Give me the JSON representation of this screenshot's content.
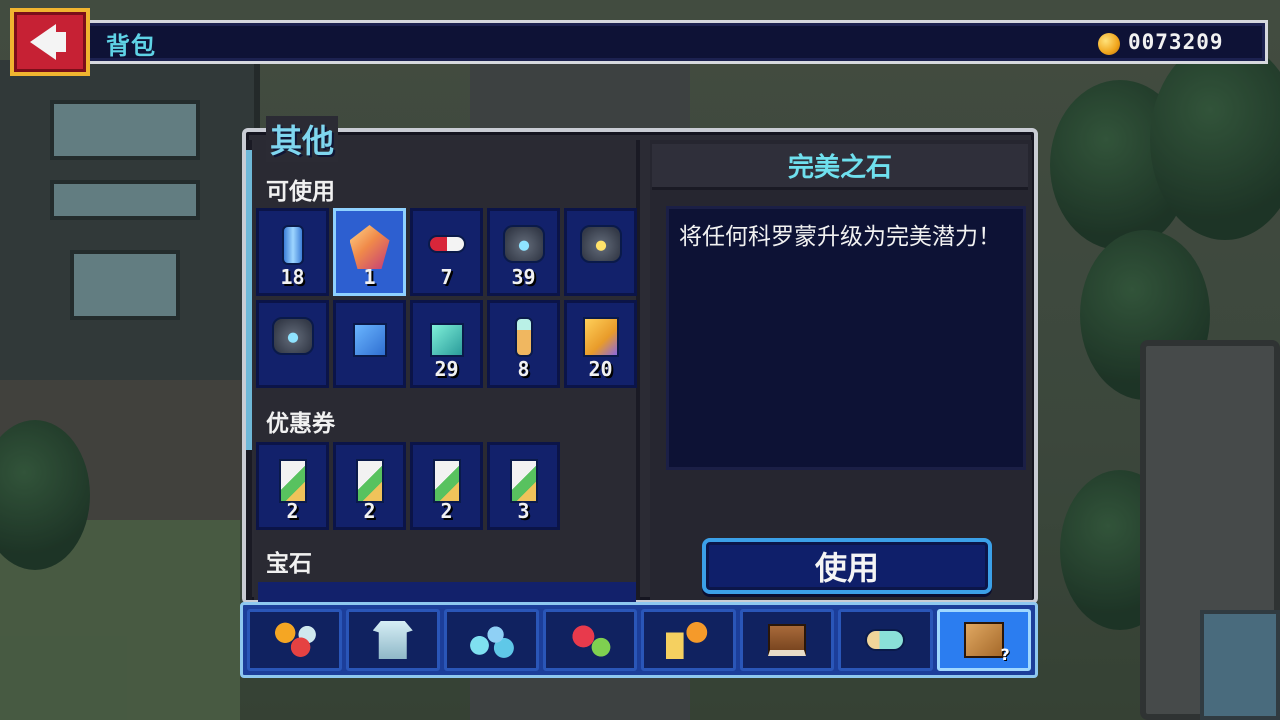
{
  "header": {
    "title": "背包",
    "coin_count": "0073209",
    "back_icon": "left-arrow-icon",
    "coin_icon": "gold-coin-icon"
  },
  "panel": {
    "title": "其他"
  },
  "sections": {
    "usable": {
      "label": "可使用",
      "items": [
        {
          "icon": "blue-cylinder-icon",
          "count": "18"
        },
        {
          "icon": "perfect-stone-gem-icon",
          "count": "1",
          "selected": true
        },
        {
          "icon": "capsule-pill-icon",
          "count": "7"
        },
        {
          "icon": "blue-core-stone-icon",
          "count": "39"
        },
        {
          "icon": "gold-core-stone-icon",
          "count": ""
        },
        {
          "icon": "blue-core-stone-icon",
          "count": ""
        },
        {
          "icon": "blue-diamond-icon",
          "count": ""
        },
        {
          "icon": "teal-diamond-icon",
          "count": "29"
        },
        {
          "icon": "potion-bottle-icon",
          "count": "8"
        },
        {
          "icon": "gold-scroll-icon",
          "count": "20"
        }
      ]
    },
    "coupons": {
      "label": "优惠券",
      "items": [
        {
          "icon": "coupon-card-icon",
          "count": "2"
        },
        {
          "icon": "coupon-card-icon",
          "count": "2"
        },
        {
          "icon": "coupon-card-icon",
          "count": "2"
        },
        {
          "icon": "coupon-card-icon",
          "count": "3"
        }
      ]
    },
    "gems": {
      "label": "宝石"
    }
  },
  "detail": {
    "title": "完美之石",
    "description": "将任何科罗蒙升级为完美潜力！",
    "use_label": "使用"
  },
  "tabs": [
    {
      "icon": "food-icon",
      "active": false
    },
    {
      "icon": "armor-icon",
      "active": false
    },
    {
      "icon": "orbs-icon",
      "active": false
    },
    {
      "icon": "heart-potion-icon",
      "active": false
    },
    {
      "icon": "drinks-icon",
      "active": false
    },
    {
      "icon": "book-icon",
      "active": false
    },
    {
      "icon": "scroll-icon",
      "active": false
    },
    {
      "icon": "mystery-box-icon",
      "active": true
    }
  ],
  "colors": {
    "accent_cyan": "#5fd3e6",
    "slot_bg": "#12216b",
    "slot_selected": "#2d5fd0",
    "back_red": "#c62134"
  }
}
